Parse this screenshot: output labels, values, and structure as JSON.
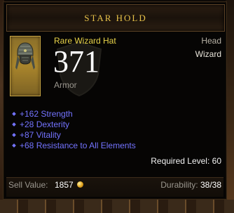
{
  "tooltip": {
    "header_title": "Star Hold",
    "item_name": "Rare Wizard Hat",
    "slot_type": "Head",
    "class_name": "Wizard",
    "armor_value": "371",
    "armor_label": "Armor",
    "affixes": [
      "+162 Strength",
      "+28 Dexterity",
      "+87 Vitality",
      "+68 Resistance to All Elements"
    ],
    "required_level_label": "Required Level:",
    "required_level": "60",
    "sell_label": "Sell Value:",
    "sell_value": "1857",
    "durability_label": "Durability:",
    "durability_value": "38/38",
    "icon": "wizard-hat-icon",
    "currency_icon": "gold-coin-icon"
  },
  "colors": {
    "rare_yellow": "#e9d44a",
    "affix_blue": "#7373ff",
    "header_gold": "#e8c24a"
  }
}
